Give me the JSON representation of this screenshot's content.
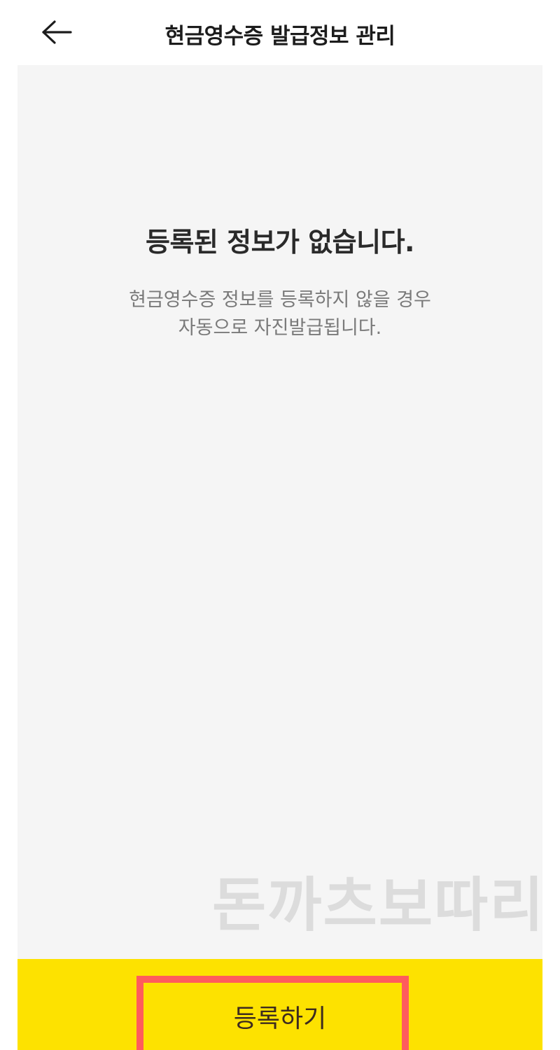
{
  "header": {
    "back_icon": "arrow-left-icon",
    "title": "현금영수증 발급정보 관리"
  },
  "empty_state": {
    "title": "등록된 정보가 없습니다.",
    "description_line1": "현금영수증 정보를 등록하지 않을 경우",
    "description_line2": "자동으로 자진발급됩니다."
  },
  "watermark": {
    "text": "돈까츠보따리"
  },
  "footer": {
    "register_label": "등록하기"
  },
  "colors": {
    "accent_yellow": "#fde200",
    "highlight_red": "#ff5c5c",
    "content_bg": "#f5f5f5"
  }
}
